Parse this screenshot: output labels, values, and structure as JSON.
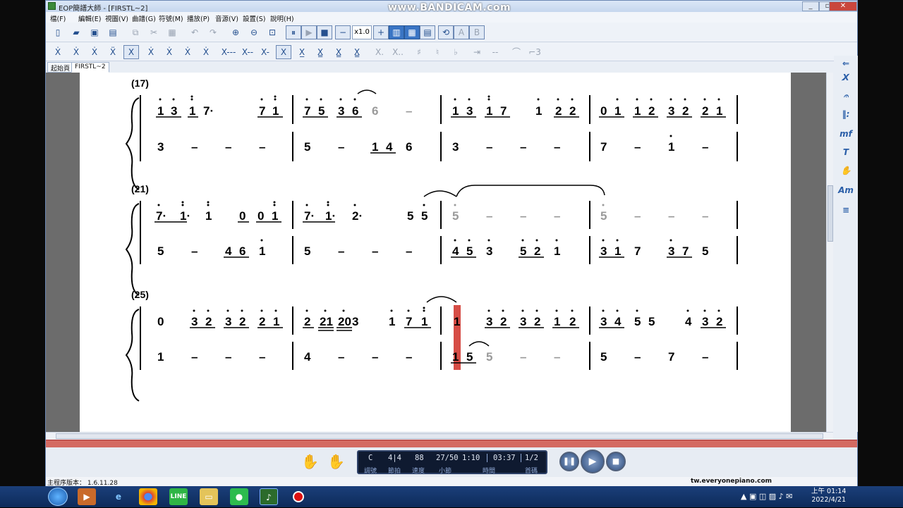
{
  "window": {
    "title": "EOP簡譜大師 - [FIRSTL~2]",
    "watermark": "www.BANDICAM.com",
    "min": "_",
    "max": "▫",
    "close": "✕"
  },
  "menu": [
    "檔(F)",
    "編輯(E)",
    "視圖(V)",
    "曲譜(G)",
    "符號(M)",
    "播放(P)",
    "音源(V)",
    "設置(S)",
    "說明(H)"
  ],
  "toolbar": {
    "speed": "x1.0"
  },
  "tabs": [
    "起始頁",
    "FIRSTL~2"
  ],
  "score": {
    "systems": [
      {
        "number": "(17)",
        "treble": "1 3 1 7·  7 1 | 7 5 3 6 6 – | 1 3 1 7 1 2 2 | 0 1 1 2 3 2 2 1",
        "bass": "3 – – – | 5 – 1 4 6 | 3 – – – | 7 – 1 –"
      },
      {
        "number": "(21)",
        "treble": "7· 1· 1 0 0 1 | 7· 1· 2· 5 5 | 5 – – – | 5 – – –",
        "bass": "5 – 4 6 1 | 5 – – – | 4 5 3 5 2 1 | 3 1 7 3 7 5"
      },
      {
        "number": "(25)",
        "treble": "0 3 2 3 2 2 1 | 2 21 20 3 1 7 1 | 1 3 2 3 2 1 2 | 3 4 5 5 4 3 2",
        "bass": "1 – – – | 4 – – – | 1 5 5 – – | 5 – 7 –"
      }
    ]
  },
  "player": {
    "key": "C",
    "time_sig": "4|4",
    "tempo": "88",
    "measure": "27/50",
    "position": "1:10",
    "duration": "03:37",
    "part": "1/2",
    "labels": [
      "調號",
      "節拍",
      "速度",
      "小節",
      "時間",
      "首碼"
    ]
  },
  "status": {
    "version": "主程序版本： 1.6.11.28",
    "website": "tw.everyonepiano.com"
  },
  "taskbar": {
    "clock_time": "上午 01:14",
    "clock_date": "2022/4/21"
  }
}
